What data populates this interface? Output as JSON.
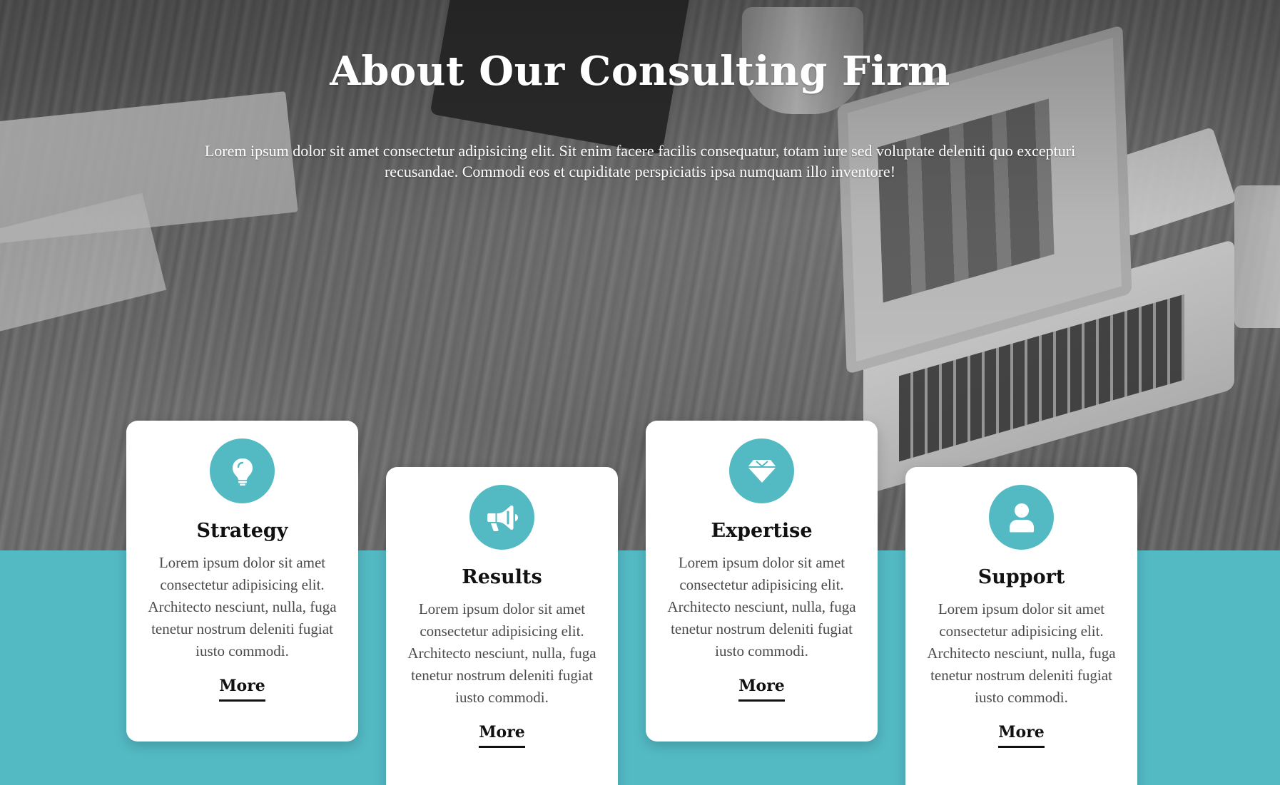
{
  "colors": {
    "accent": "#53BAC4",
    "card_background": "#FFFFFF",
    "title_text": "#111111",
    "body_text": "#4A4A4A",
    "hero_text": "#FFFFFF"
  },
  "hero": {
    "title": "About Our Consulting Firm",
    "description": "Lorem ipsum dolor sit amet consectetur adipisicing elit. Sit enim facere facilis consequatur, totam iure sed voluptate deleniti quo excepturi recusandae. Commodi eos et cupiditate perspiciatis ipsa numquam illo inventore!"
  },
  "cards": [
    {
      "icon": "lightbulb-icon",
      "title": "Strategy",
      "text": "Lorem ipsum dolor sit amet consectetur adipisicing elit. Architecto nesciunt, nulla, fuga tenetur nostrum deleniti fugiat iusto commodi.",
      "link_label": "More"
    },
    {
      "icon": "megaphone-icon",
      "title": "Results",
      "text": "Lorem ipsum dolor sit amet consectetur adipisicing elit. Architecto nesciunt, nulla, fuga tenetur nostrum deleniti fugiat iusto commodi.",
      "link_label": "More"
    },
    {
      "icon": "gem-icon",
      "title": "Expertise",
      "text": "Lorem ipsum dolor sit amet consectetur adipisicing elit. Architecto nesciunt, nulla, fuga tenetur nostrum deleniti fugiat iusto commodi.",
      "link_label": "More"
    },
    {
      "icon": "user-icon",
      "title": "Support",
      "text": "Lorem ipsum dolor sit amet consectetur adipisicing elit. Architecto nesciunt, nulla, fuga tenetur nostrum deleniti fugiat iusto commodi.",
      "link_label": "More"
    }
  ]
}
